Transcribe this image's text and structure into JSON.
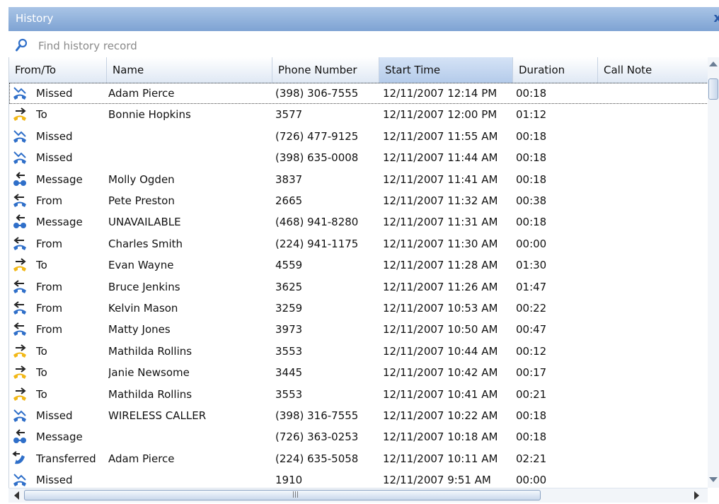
{
  "window": {
    "title": "History",
    "close_glyph": "x"
  },
  "search": {
    "placeholder": "Find history record",
    "value": ""
  },
  "columns": [
    "From/To",
    "Name",
    "Phone Number",
    "Start Time",
    "Duration",
    "Call Note"
  ],
  "sort": {
    "column": "Start Time",
    "direction": "descending"
  },
  "rows": [
    {
      "type": "missed",
      "from_to": "Missed",
      "name": "Adam Pierce",
      "phone": "(398) 306-7555",
      "start": "12/11/2007 12:14 PM",
      "duration": "00:18",
      "note": "",
      "selected": true
    },
    {
      "type": "to",
      "from_to": "To",
      "name": "Bonnie Hopkins",
      "phone": "3577",
      "start": "12/11/2007 12:00 PM",
      "duration": "01:12",
      "note": ""
    },
    {
      "type": "missed",
      "from_to": "Missed",
      "name": "",
      "phone": "(726) 477-9125",
      "start": "12/11/2007 11:55 AM",
      "duration": "00:18",
      "note": ""
    },
    {
      "type": "missed",
      "from_to": "Missed",
      "name": "",
      "phone": "(398) 635-0008",
      "start": "12/11/2007 11:44 AM",
      "duration": "00:18",
      "note": ""
    },
    {
      "type": "message",
      "from_to": "Message",
      "name": "Molly Ogden",
      "phone": "3837",
      "start": "12/11/2007 11:41 AM",
      "duration": "00:18",
      "note": ""
    },
    {
      "type": "from",
      "from_to": "From",
      "name": "Pete Preston",
      "phone": "2665",
      "start": "12/11/2007 11:32 AM",
      "duration": "00:38",
      "note": ""
    },
    {
      "type": "message",
      "from_to": "Message",
      "name": "UNAVAILABLE",
      "phone": "(468) 941-8280",
      "start": "12/11/2007 11:31 AM",
      "duration": "00:18",
      "note": ""
    },
    {
      "type": "from",
      "from_to": "From",
      "name": "Charles Smith",
      "phone": "(224) 941-1175",
      "start": "12/11/2007 11:30 AM",
      "duration": "00:00",
      "note": ""
    },
    {
      "type": "to",
      "from_to": "To",
      "name": "Evan Wayne",
      "phone": "4559",
      "start": "12/11/2007 11:28 AM",
      "duration": "01:30",
      "note": ""
    },
    {
      "type": "from",
      "from_to": "From",
      "name": "Bruce Jenkins",
      "phone": "3625",
      "start": "12/11/2007 11:26 AM",
      "duration": "01:47",
      "note": ""
    },
    {
      "type": "from",
      "from_to": "From",
      "name": "Kelvin Mason",
      "phone": "3259",
      "start": "12/11/2007 10:53 AM",
      "duration": "00:22",
      "note": ""
    },
    {
      "type": "from",
      "from_to": "From",
      "name": "Matty Jones",
      "phone": "3973",
      "start": "12/11/2007 10:50 AM",
      "duration": "00:47",
      "note": ""
    },
    {
      "type": "to",
      "from_to": "To",
      "name": "Mathilda Rollins",
      "phone": "3553",
      "start": "12/11/2007 10:44 AM",
      "duration": "00:12",
      "note": ""
    },
    {
      "type": "to",
      "from_to": "To",
      "name": "Janie Newsome",
      "phone": "3445",
      "start": "12/11/2007 10:42 AM",
      "duration": "00:17",
      "note": ""
    },
    {
      "type": "to",
      "from_to": "To",
      "name": "Mathilda Rollins",
      "phone": "3553",
      "start": "12/11/2007 10:41 AM",
      "duration": "00:21",
      "note": ""
    },
    {
      "type": "missed",
      "from_to": "Missed",
      "name": "WIRELESS CALLER",
      "phone": "(398) 316-7555",
      "start": "12/11/2007 10:22 AM",
      "duration": "00:18",
      "note": ""
    },
    {
      "type": "message",
      "from_to": "Message",
      "name": "",
      "phone": "(726) 363-0253",
      "start": "12/11/2007 10:18 AM",
      "duration": "00:18",
      "note": ""
    },
    {
      "type": "transferred",
      "from_to": "Transferred",
      "name": "Adam Pierce",
      "phone": "(224) 635-5058",
      "start": "12/11/2007 10:11 AM",
      "duration": "02:21",
      "note": ""
    },
    {
      "type": "missed",
      "from_to": "Missed",
      "name": "",
      "phone": "1910",
      "start": "12/11/2007 9:51 AM",
      "duration": "00:00",
      "note": ""
    }
  ],
  "icons": {
    "missed": "missed-call-icon",
    "to": "outgoing-call-icon",
    "from": "incoming-call-icon",
    "message": "voicemail-icon",
    "transferred": "transferred-call-icon",
    "search": "search-icon"
  },
  "colors": {
    "accent_blue": "#2f6fc9",
    "outgoing_yellow": "#f2b817",
    "titlebar": "#8eb0dc"
  }
}
